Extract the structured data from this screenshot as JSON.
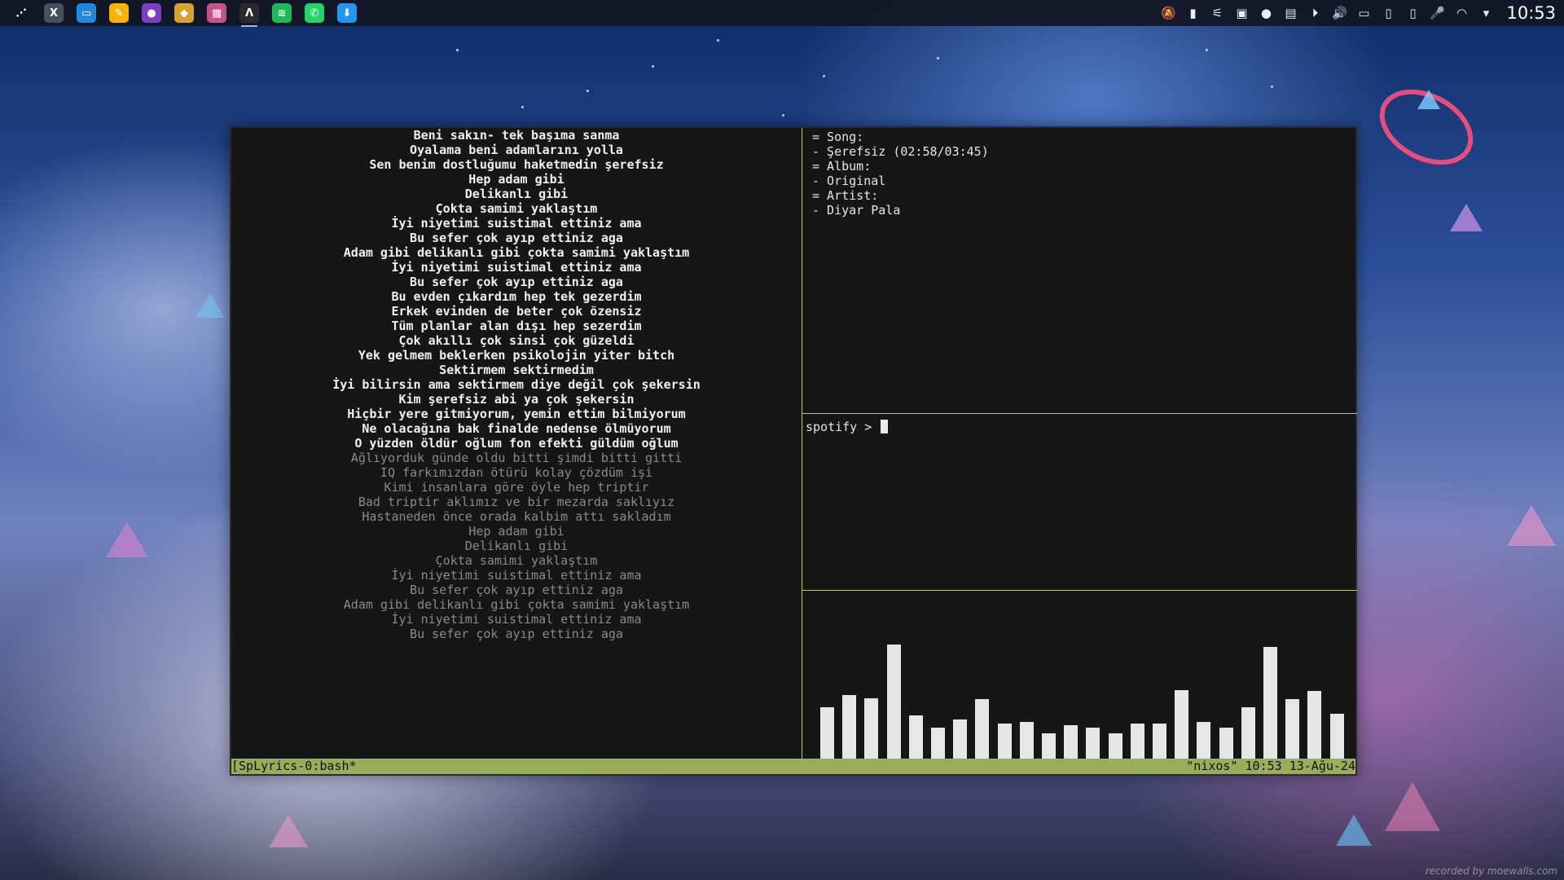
{
  "taskbar": {
    "launchers": [
      {
        "name": "app-menu-icon",
        "color": "transparent",
        "glyph": "⋰"
      },
      {
        "name": "x-app-icon",
        "color": "#4b4f5c",
        "glyph": "X"
      },
      {
        "name": "file-manager-icon",
        "color": "#1e88e5",
        "glyph": "▭"
      },
      {
        "name": "notes-icon",
        "color": "#f4b400",
        "glyph": "✎"
      },
      {
        "name": "firefox-icon",
        "color": "#7b3fc4",
        "glyph": "●"
      },
      {
        "name": "bottle-icon",
        "color": "#d9a12f",
        "glyph": "◆"
      },
      {
        "name": "palette-icon",
        "color": "#c2548a",
        "glyph": "▦"
      },
      {
        "name": "terminal-icon",
        "color": "#2a2a2a",
        "glyph": "Λ"
      },
      {
        "name": "spotify-icon",
        "color": "#1db954",
        "glyph": "≋"
      },
      {
        "name": "whatsapp-icon",
        "color": "#25d366",
        "glyph": "✆"
      },
      {
        "name": "store-icon",
        "color": "#2196f3",
        "glyph": "⬇"
      }
    ],
    "active_index": 7,
    "tray": [
      "bell-off-icon",
      "battery-status-icon",
      "bluetooth-icon",
      "color-app-icon",
      "whatsapp-tray-icon",
      "clipboard-icon",
      "media-play-icon",
      "volume-icon",
      "battery-icon",
      "usb-icon",
      "phone-connect-icon",
      "microphone-icon",
      "wifi-icon",
      "chevron-down-icon"
    ],
    "tray_glyphs": [
      "🔕",
      "▮",
      "⚟",
      "▣",
      "●",
      "▤",
      "⏵",
      "🔊",
      "▭",
      "▯",
      "▯",
      "🎤",
      "◠",
      "▾"
    ],
    "clock": "10:53"
  },
  "terminal": {
    "lyrics": [
      {
        "text": "Beni sakın- tek başıma sanma",
        "state": "past"
      },
      {
        "text": "Oyalama beni adamlarını yolla",
        "state": "past"
      },
      {
        "text": "Sen benim dostluğumu haketmedin şerefsiz",
        "state": "past"
      },
      {
        "text": "Hep adam gibi",
        "state": "past"
      },
      {
        "text": "Delikanlı gibi",
        "state": "past"
      },
      {
        "text": "Çokta samimi yaklaştım",
        "state": "past"
      },
      {
        "text": "İyi niyetimi suistimal ettiniz ama",
        "state": "past"
      },
      {
        "text": "Bu sefer çok ayıp ettiniz aga",
        "state": "past"
      },
      {
        "text": "Adam gibi delikanlı gibi çokta samimi yaklaştım",
        "state": "past"
      },
      {
        "text": "İyi niyetimi suistimal ettiniz ama",
        "state": "past"
      },
      {
        "text": "Bu sefer çok ayıp ettiniz aga",
        "state": "past"
      },
      {
        "text": "Bu evden çıkardım hep tek gezerdim",
        "state": "past"
      },
      {
        "text": "Erkek evinden de beter çok özensiz",
        "state": "past"
      },
      {
        "text": "Tüm planlar alan dışı hep sezerdim",
        "state": "past"
      },
      {
        "text": "Çok akıllı çok sinsi çok güzeldi",
        "state": "past"
      },
      {
        "text": "Yek gelmem beklerken psikolojin yiter bitch",
        "state": "past"
      },
      {
        "text": "Sektirmem sektirmedim",
        "state": "past"
      },
      {
        "text": "İyi bilirsin ama sektirmem diye değil çok şekersin",
        "state": "past"
      },
      {
        "text": "Kim şerefsiz abi ya çok şekersin",
        "state": "past"
      },
      {
        "text": "Hiçbir yere gitmiyorum, yemin ettim bilmiyorum",
        "state": "past"
      },
      {
        "text": "Ne olacağına bak finalde nedense ölmüyorum",
        "state": "past"
      },
      {
        "text": "O yüzden öldür oğlum fon efekti güldüm oğlum",
        "state": "past"
      },
      {
        "text": "Ağlıyorduk günde oldu bitti şimdi bitti gitti",
        "state": "future"
      },
      {
        "text": "IQ farkımızdan ötürü kolay çözdüm işi",
        "state": "future"
      },
      {
        "text": "Kimi insanlara göre öyle hep triptir",
        "state": "future"
      },
      {
        "text": "Bad triptir aklımız ve bir mezarda saklıyız",
        "state": "future"
      },
      {
        "text": "Hastaneden önce orada kalbim attı sakladım",
        "state": "future"
      },
      {
        "text": "Hep adam gibi",
        "state": "future"
      },
      {
        "text": "Delikanlı gibi",
        "state": "future"
      },
      {
        "text": "Çokta samimi yaklaştım",
        "state": "future"
      },
      {
        "text": "İyi niyetimi suistimal ettiniz ama",
        "state": "future"
      },
      {
        "text": "Bu sefer çok ayıp ettiniz aga",
        "state": "future"
      },
      {
        "text": "Adam gibi delikanlı gibi çokta samimi yaklaştım",
        "state": "future"
      },
      {
        "text": "İyi niyetimi suistimal ettiniz ama",
        "state": "future"
      },
      {
        "text": "Bu sefer çok ayıp ettiniz aga",
        "state": "future"
      }
    ],
    "info": {
      "song_label": "= Song:",
      "song_value": "- Şerefsiz (02:58/03:45)",
      "album_label": "= Album:",
      "album_value": "- Original",
      "artist_label": "= Artist:",
      "artist_value": "- Diyar Pala"
    },
    "prompt": "spotify > ",
    "visualizer_levels": [
      0.45,
      0.56,
      0.53,
      1.0,
      0.38,
      0.27,
      0.34,
      0.52,
      0.31,
      0.32,
      0.22,
      0.29,
      0.27,
      0.22,
      0.31,
      0.31,
      0.6,
      0.32,
      0.27,
      0.45,
      0.98,
      0.52,
      0.59,
      0.39
    ],
    "status_left": "[SpLyrics-0:bash*",
    "status_right": "\"nixos\" 10:53 13-Ağu-24"
  },
  "watermark": "recorded by moewalls.com"
}
